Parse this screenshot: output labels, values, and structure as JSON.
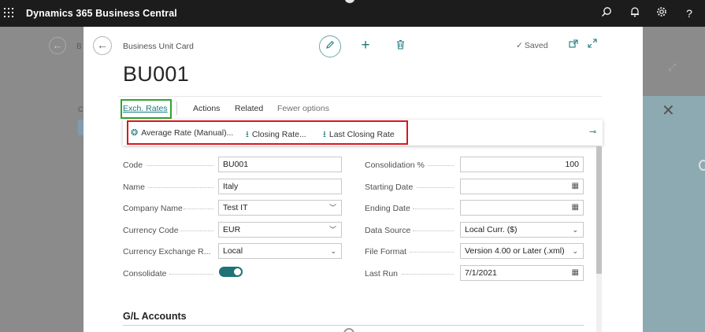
{
  "app": {
    "title": "Dynamics 365 Business Central"
  },
  "background": {
    "breadcrumb_fragment": "B",
    "side_fragment": "C"
  },
  "card": {
    "breadcrumb": "Business Unit Card",
    "title": "BU001",
    "saved": "Saved"
  },
  "actions": {
    "exch_rates": "Exch. Rates",
    "actions": "Actions",
    "related": "Related",
    "fewer_options": "Fewer options"
  },
  "flyout": {
    "average_rate": "Average Rate (Manual)...",
    "closing_rate": "Closing Rate...",
    "last_closing_rate": "Last Closing Rate"
  },
  "form_left": [
    {
      "label": "Code",
      "value": "BU001",
      "kind": "text"
    },
    {
      "label": "Name",
      "value": "Italy",
      "kind": "text"
    },
    {
      "label": "Company Name",
      "value": "Test IT",
      "kind": "dropdown-flat"
    },
    {
      "label": "Currency Code",
      "value": "EUR",
      "kind": "dropdown-flat"
    },
    {
      "label": "Currency Exchange R...",
      "value": "Local",
      "kind": "select"
    },
    {
      "label": "Consolidate",
      "value": true,
      "kind": "toggle"
    }
  ],
  "form_right": [
    {
      "label": "Consolidation %",
      "value": "100",
      "kind": "number"
    },
    {
      "label": "Starting Date",
      "value": "",
      "kind": "date"
    },
    {
      "label": "Ending Date",
      "value": "",
      "kind": "date"
    },
    {
      "label": "Data Source",
      "value": "Local Curr. ($)",
      "kind": "select"
    },
    {
      "label": "File Format",
      "value": "Version 4.00 or Later (.xml)",
      "kind": "select"
    },
    {
      "label": "Last Run",
      "value": "7/1/2021",
      "kind": "date"
    }
  ],
  "sections": {
    "gl_accounts": "G/L Accounts"
  },
  "colors": {
    "accent": "#1a7a7c",
    "appbar": "#1c1c1c",
    "highlight_green": "#2ea62e",
    "highlight_red": "#d6171f"
  },
  "icons": [
    "waffle-icon",
    "search-icon",
    "bell-icon",
    "gear-icon",
    "help-icon",
    "back-arrow-icon",
    "pencil-icon",
    "plus-icon",
    "trash-icon",
    "check-icon",
    "popout-icon",
    "expand-icon",
    "average-rate-icon",
    "download-icon",
    "pin-icon",
    "chevron-down-icon",
    "calendar-icon"
  ]
}
